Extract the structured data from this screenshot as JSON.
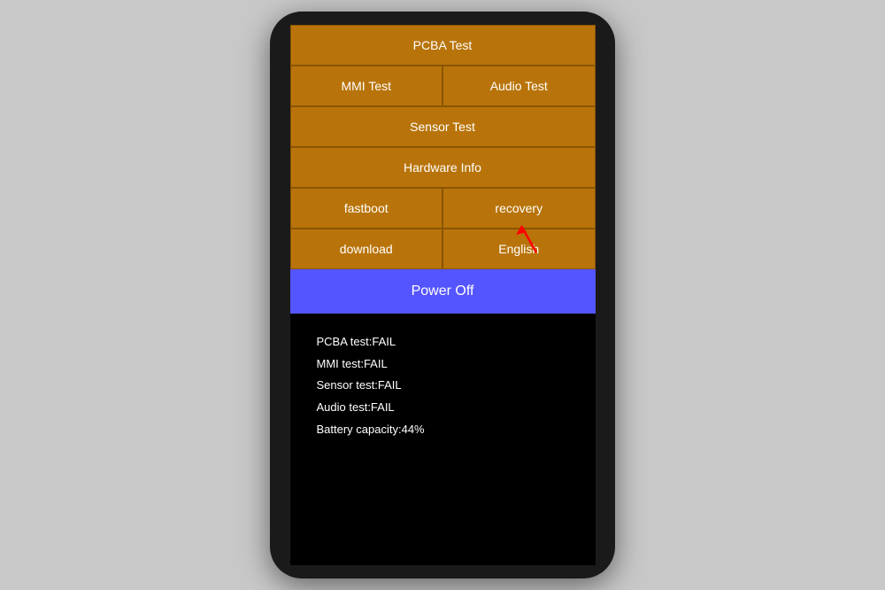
{
  "buttons": {
    "pcba_test": "PCBA Test",
    "mmi_test": "MMI Test",
    "audio_test": "Audio Test",
    "sensor_test": "Sensor Test",
    "hardware_info": "Hardware Info",
    "fastboot": "fastboot",
    "recovery": "recovery",
    "download": "download",
    "english": "English",
    "power_off": "Power Off"
  },
  "status": {
    "pcba": "PCBA test:FAIL",
    "mmi": "MMI test:FAIL",
    "sensor": "Sensor test:FAIL",
    "audio": "Audio test:FAIL",
    "battery": "Battery capacity:44%"
  }
}
